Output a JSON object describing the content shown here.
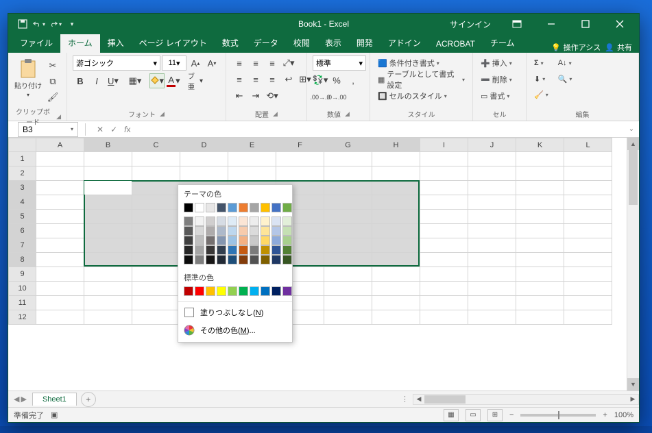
{
  "title": "Book1 - Excel",
  "signin": "サインイン",
  "tabs": [
    "ファイル",
    "ホーム",
    "挿入",
    "ページ レイアウト",
    "数式",
    "データ",
    "校閲",
    "表示",
    "開発",
    "アドイン",
    "ACROBAT",
    "チーム"
  ],
  "active_tab": 1,
  "tell_me": "操作アシス",
  "share": "共有",
  "ribbon": {
    "clipboard": {
      "paste": "貼り付け",
      "label": "クリップボード"
    },
    "font": {
      "name": "游ゴシック",
      "size": "11",
      "label": "フォント"
    },
    "align": {
      "ruby": "ブ亜",
      "label": "配置"
    },
    "number": {
      "fmt": "標準",
      "label": "数値"
    },
    "styles": {
      "cond": "条件付き書式",
      "table": "テーブルとして書式設定",
      "cell": "セルのスタイル",
      "label": "スタイル"
    },
    "cells": {
      "insert": "挿入",
      "delete": "削除",
      "format": "書式",
      "label": "セル"
    },
    "editing": {
      "label": "編集"
    }
  },
  "namebox": "B3",
  "columns": [
    "A",
    "B",
    "C",
    "D",
    "E",
    "F",
    "G",
    "H",
    "I",
    "J",
    "K",
    "L"
  ],
  "rows": [
    "1",
    "2",
    "3",
    "4",
    "5",
    "6",
    "7",
    "8",
    "9",
    "10",
    "11",
    "12"
  ],
  "selection": {
    "active": "B3",
    "range": "B3:H8"
  },
  "sheet_tab": "Sheet1",
  "status": {
    "ready": "準備完了",
    "zoom": "100%"
  },
  "color_popup": {
    "theme_label": "テーマの色",
    "theme_row1": [
      "#000000",
      "#ffffff",
      "#e7e6e6",
      "#44546a",
      "#5b9bd5",
      "#ed7d31",
      "#a5a5a5",
      "#ffc000",
      "#4472c4",
      "#70ad47"
    ],
    "theme_shades": [
      [
        "#7f7f7f",
        "#f2f2f2",
        "#d0cece",
        "#d6dce4",
        "#deebf6",
        "#fbe5d5",
        "#ededed",
        "#fff2cc",
        "#dae3f3",
        "#e2efd9"
      ],
      [
        "#595959",
        "#d8d8d8",
        "#aeabab",
        "#adb9ca",
        "#bdd7ee",
        "#f7cbac",
        "#dbdbdb",
        "#fee599",
        "#b4c6e7",
        "#c5e0b3"
      ],
      [
        "#3f3f3f",
        "#bfbfbf",
        "#757070",
        "#8496b0",
        "#9cc3e5",
        "#f4b183",
        "#c9c9c9",
        "#ffd965",
        "#8eaadb",
        "#a8d08d"
      ],
      [
        "#262626",
        "#a5a5a5",
        "#3a3838",
        "#323f4f",
        "#2e75b5",
        "#c55a11",
        "#7b7b7b",
        "#bf9000",
        "#2f5496",
        "#538135"
      ],
      [
        "#0c0c0c",
        "#7f7f7f",
        "#171616",
        "#222a35",
        "#1e4e79",
        "#833c0b",
        "#525252",
        "#7f6000",
        "#1f3864",
        "#375623"
      ]
    ],
    "std_label": "標準の色",
    "std": [
      "#c00000",
      "#ff0000",
      "#ffc000",
      "#ffff00",
      "#92d050",
      "#00b050",
      "#00b0f0",
      "#0070c0",
      "#002060",
      "#7030a0"
    ],
    "nofill": "塗りつぶしなし(",
    "nofill_key": "N",
    "nofill_close": ")",
    "more": "その他の色(",
    "more_key": "M",
    "more_close": ")..."
  }
}
